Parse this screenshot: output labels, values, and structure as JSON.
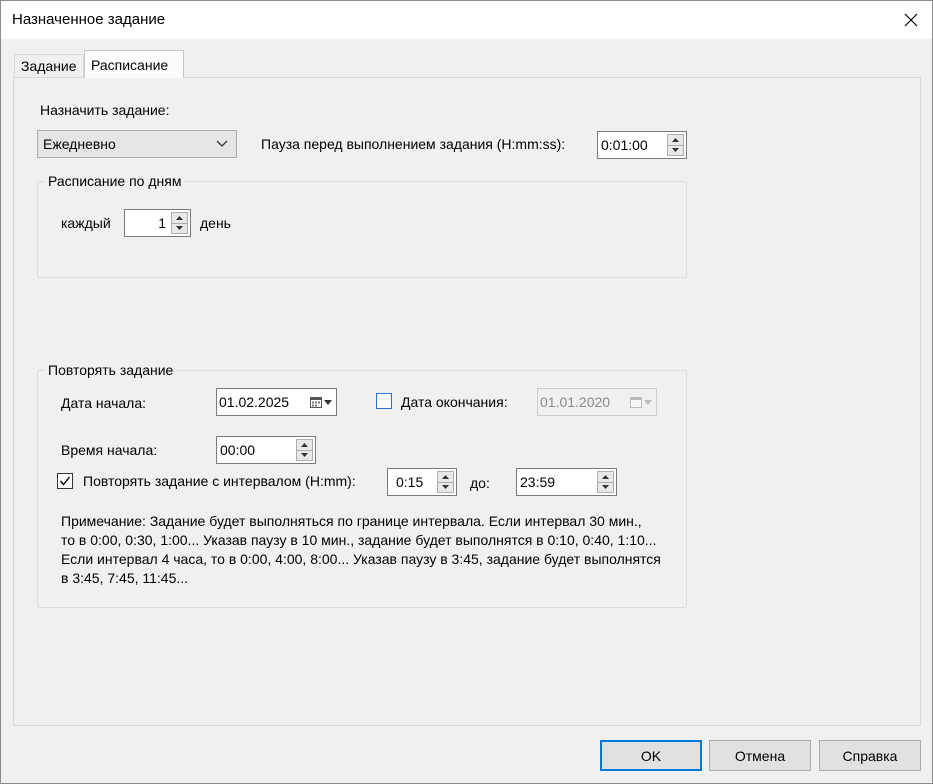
{
  "window": {
    "title": "Назначенное задание"
  },
  "tabs": [
    {
      "label": "Задание"
    },
    {
      "label": "Расписание"
    }
  ],
  "schedule": {
    "assign_label": "Назначить задание:",
    "frequency_value": "Ежедневно",
    "pause_label": "Пауза перед выполнением задания (H:mm:ss):",
    "pause_value": "0:01:00"
  },
  "daily": {
    "group_title": "Расписание по дням",
    "every_label": "каждый",
    "every_value": "1",
    "unit_label": "день"
  },
  "repeat": {
    "group_title": "Повторять задание",
    "start_date_label": "Дата начала:",
    "start_date_value": "01.02.2025",
    "end_date_label": "Дата окончания:",
    "end_date_value": "01.01.2020",
    "end_date_checked": false,
    "start_time_label": "Время начала:",
    "start_time_value": "00:00",
    "interval_label": "Повторять задание с интервалом (H:mm):",
    "interval_checked": true,
    "interval_value": "0:15",
    "until_label": "до:",
    "until_value": "23:59",
    "note_lines": [
      "Примечание: Задание будет выполняться по границе интервала. Если интервал 30 мин.,",
      "то в 0:00, 0:30, 1:00... Указав паузу в 10 мин., задание будет выполнятся в 0:10, 0:40, 1:10...",
      "Если интервал 4 часа, то в 0:00, 4:00, 8:00... Указав паузу в 3:45, задание будет выполнятся",
      "в 3:45, 7:45, 11:45..."
    ]
  },
  "buttons": {
    "ok": "OK",
    "cancel": "Отмена",
    "help": "Справка"
  },
  "icons": {
    "close": "close-icon",
    "dropdown": "chevron-down-icon",
    "calendar": "calendar-icon",
    "spin_up": "triangle-up-icon",
    "spin_down": "triangle-down-icon",
    "check": "checkmark-icon"
  },
  "colors": {
    "default_button_border": "#0078d7",
    "checkbox_unchecked_border": "#2b6fcf"
  }
}
